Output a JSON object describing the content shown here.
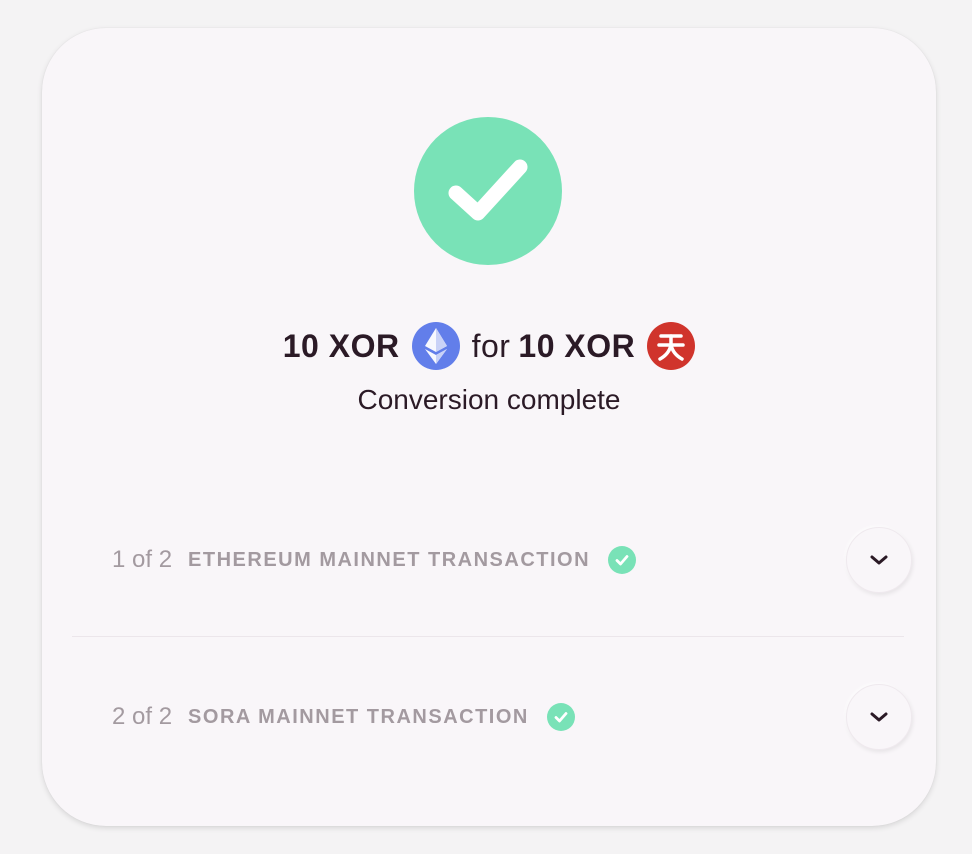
{
  "summary": {
    "from_amount": "10 XOR",
    "from_icon": "ethereum-icon",
    "connector": "for",
    "to_amount": "10 XOR",
    "to_icon": "sora-icon"
  },
  "status": {
    "icon": "checkmark-icon",
    "text": "Conversion complete"
  },
  "transactions": [
    {
      "step": "1 of 2",
      "label": "ETHEREUM MAINNET TRANSACTION",
      "status_icon": "check-circle-icon",
      "expand_icon": "chevron-down-icon"
    },
    {
      "step": "2 of 2",
      "label": "SORA MAINNET TRANSACTION",
      "status_icon": "check-circle-icon",
      "expand_icon": "chevron-down-icon"
    }
  ],
  "colors": {
    "success": "#79e2b7",
    "text_primary": "#2b1a26",
    "text_muted": "#a39aa0",
    "ethereum": "#627eea",
    "sora": "#d0342c"
  }
}
